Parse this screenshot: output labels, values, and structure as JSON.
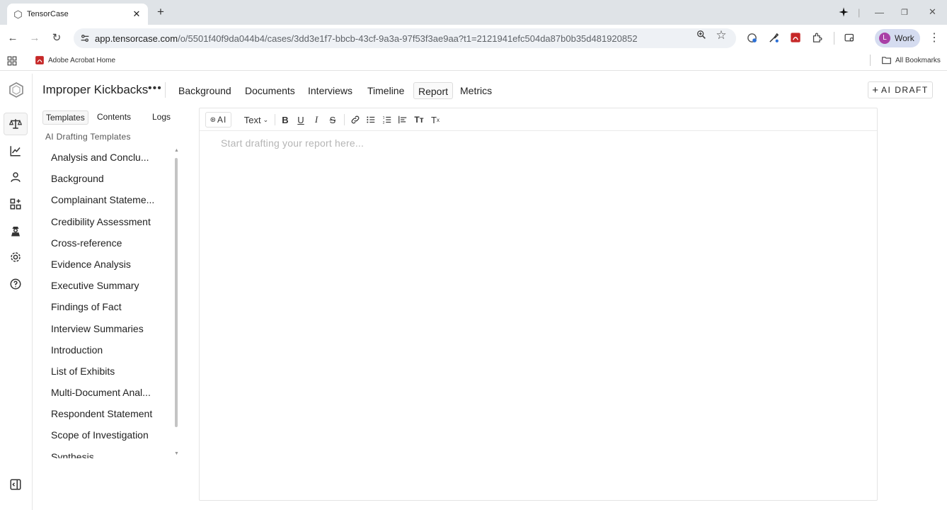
{
  "browser": {
    "tab_title": "TensorCase",
    "url_host": "app.tensorcase.com",
    "url_path": "/o/5501f40f9da044b4/cases/3dd3e1f7-bbcb-43cf-9a3a-97f53f3ae9aa?t1=2121941efc504da87b0b35d481920852",
    "profile_initial": "L",
    "profile_label": "Work",
    "bookmark_1": "Adobe Acrobat Home",
    "all_bookmarks": "All Bookmarks"
  },
  "header": {
    "case_title": "Improper Kickbacks",
    "tabs": [
      "Background",
      "Documents",
      "Interviews",
      "Timeline",
      "Report",
      "Metrics"
    ],
    "active_tab": "Report",
    "ai_draft_label": "AI DRAFT"
  },
  "sidebar": {
    "tabs": [
      "Templates",
      "Contents",
      "Logs"
    ],
    "section_label": "AI Drafting Templates",
    "templates": [
      "Analysis and Conclu...",
      "Background",
      "Complainant Stateme...",
      "Credibility Assessment",
      "Cross-reference",
      "Evidence Analysis",
      "Executive Summary",
      "Findings of Fact",
      "Interview Summaries",
      "Introduction",
      "List of Exhibits",
      "Multi-Document Anal...",
      "Respondent Statement",
      "Scope of Investigation",
      "Synthesis"
    ]
  },
  "editor": {
    "ai_button": "AI",
    "text_style": "Text",
    "placeholder": "Start drafting your report here..."
  },
  "colors": {
    "accent_profile": "#a93fa6",
    "acrobat_red": "#d32f2f",
    "active_rail": "#f6f6f6"
  }
}
